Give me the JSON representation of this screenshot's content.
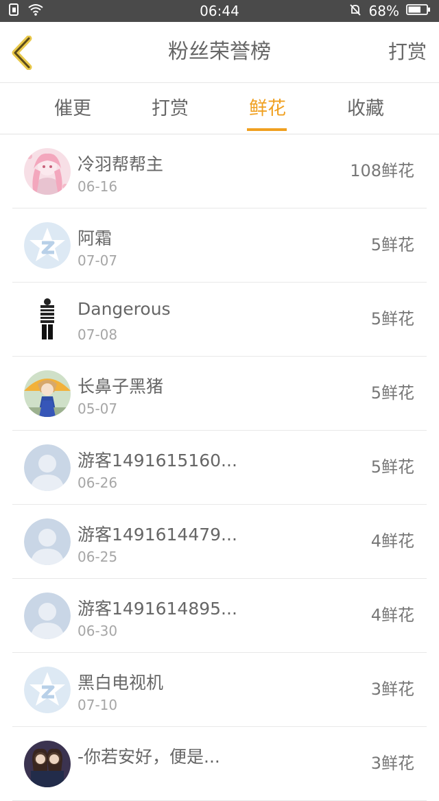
{
  "status_bar": {
    "time": "06:44",
    "battery": "68%"
  },
  "header": {
    "title": "粉丝荣誉榜",
    "action": "打赏"
  },
  "tabs": [
    {
      "label": "催更"
    },
    {
      "label": "打赏"
    },
    {
      "label": "鲜花"
    },
    {
      "label": "收藏"
    }
  ],
  "active_tab": "鲜花",
  "colors": {
    "accent": "#f0a020",
    "status_bar": "#4a4a4a"
  },
  "items": [
    {
      "name": "冷羽帮帮主",
      "date": "06-16",
      "amount": "108鲜花",
      "avatar": "anime-girl-pink"
    },
    {
      "name": "阿霜",
      "date": "07-07",
      "amount": "5鲜花",
      "avatar": "qq-star-icon"
    },
    {
      "name": "Dangerous",
      "date": "07-08",
      "amount": "5鲜花",
      "avatar": "striped-figure"
    },
    {
      "name": "长鼻子黑猪",
      "date": "05-07",
      "amount": "5鲜花",
      "avatar": "anime-girl-umbrella"
    },
    {
      "name": "游客1491615160...",
      "date": "06-26",
      "amount": "5鲜花",
      "avatar": "default-person"
    },
    {
      "name": "游客1491614479...",
      "date": "06-25",
      "amount": "4鲜花",
      "avatar": "default-person"
    },
    {
      "name": "游客1491614895...",
      "date": "06-30",
      "amount": "4鲜花",
      "avatar": "default-person"
    },
    {
      "name": "黑白电视机",
      "date": "07-10",
      "amount": "3鲜花",
      "avatar": "qq-star-icon"
    },
    {
      "name": "-你若安好，便是...",
      "date": "",
      "amount": "3鲜花",
      "avatar": "two-girls-photo"
    }
  ]
}
